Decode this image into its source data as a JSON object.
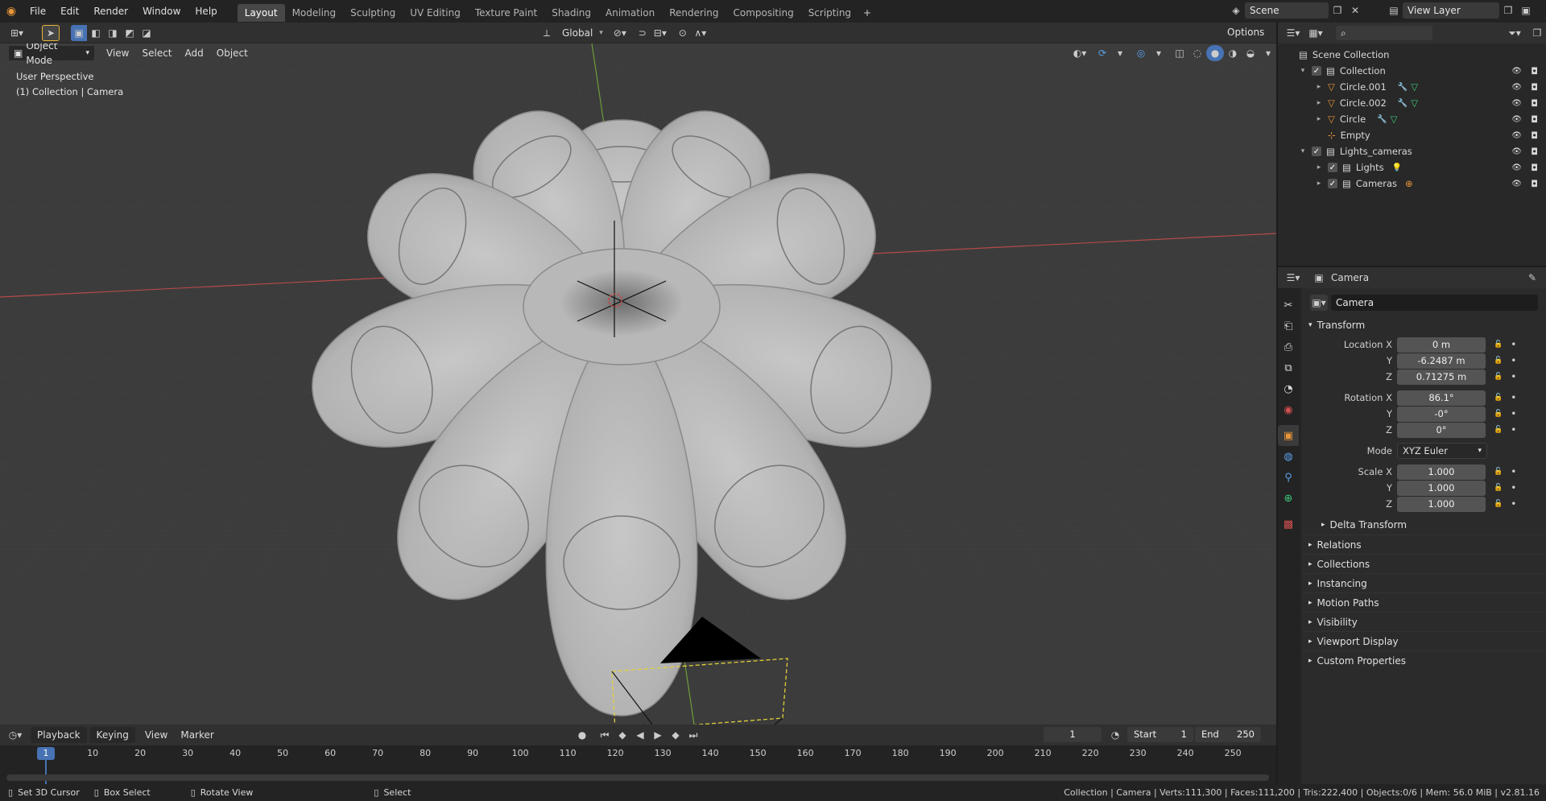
{
  "menubar": {
    "items": [
      "File",
      "Edit",
      "Render",
      "Window",
      "Help"
    ],
    "workspaces": [
      "Layout",
      "Modeling",
      "Sculpting",
      "UV Editing",
      "Texture Paint",
      "Shading",
      "Animation",
      "Rendering",
      "Compositing",
      "Scripting"
    ],
    "active_workspace": "Layout",
    "add_tab": "+",
    "scene": "Scene",
    "view_layer": "View Layer"
  },
  "viewport": {
    "transform_orientation": "Global",
    "options_label": "Options",
    "mode": "Object Mode",
    "menus": [
      "View",
      "Select",
      "Add",
      "Object"
    ],
    "perspective_label": "User Perspective",
    "context_label": "(1) Collection | Camera"
  },
  "outliner": {
    "root": "Scene Collection",
    "items": [
      {
        "name": "Collection",
        "kind": "collection"
      },
      {
        "name": "Circle.001",
        "kind": "mesh"
      },
      {
        "name": "Circle.002",
        "kind": "mesh"
      },
      {
        "name": "Circle",
        "kind": "mesh"
      },
      {
        "name": "Empty",
        "kind": "empty"
      },
      {
        "name": "Lights_cameras",
        "kind": "collection"
      },
      {
        "name": "Lights",
        "kind": "collection"
      },
      {
        "name": "Cameras",
        "kind": "collection"
      }
    ]
  },
  "properties": {
    "header_object": "Camera",
    "object_name": "Camera",
    "transform_label": "Transform",
    "location_label": "Location X",
    "rotation_label": "Rotation X",
    "scale_label": "Scale X",
    "y_label": "Y",
    "z_label": "Z",
    "mode_label": "Mode",
    "location": [
      "0 m",
      "-6.2487 m",
      "0.71275 m"
    ],
    "rotation": [
      "86.1°",
      "-0°",
      "0°"
    ],
    "mode": "XYZ Euler",
    "scale": [
      "1.000",
      "1.000",
      "1.000"
    ],
    "delta_transform": "Delta Transform",
    "panels": [
      "Relations",
      "Collections",
      "Instancing",
      "Motion Paths",
      "Visibility",
      "Viewport Display",
      "Custom Properties"
    ]
  },
  "timeline": {
    "menus": [
      "Playback",
      "Keying",
      "View",
      "Marker"
    ],
    "current_frame": "1",
    "start_label": "Start",
    "start": "1",
    "end_label": "End",
    "end": "250",
    "ticks": [
      "10",
      "20",
      "30",
      "40",
      "50",
      "60",
      "70",
      "80",
      "90",
      "100",
      "110",
      "120",
      "130",
      "140",
      "150",
      "160",
      "170",
      "180",
      "190",
      "200",
      "210",
      "220",
      "230",
      "240",
      "250"
    ],
    "cursor_frame": "1"
  },
  "statusbar": {
    "hints": [
      "Set 3D Cursor",
      "Box Select",
      "Rotate View",
      "Select"
    ],
    "stats": "Collection | Camera | Verts:111,300 | Faces:111,200 | Tris:222,400 | Objects:0/6 | Mem: 56.0 MiB | v2.81.16"
  },
  "colors": {
    "accent_blue": "#4772b3",
    "viewport_bg": "#3c3c3c",
    "panel_bg": "#282828",
    "mesh_orange": "#e8963a",
    "modifier_blue": "#5aa0e8",
    "data_green": "#3ec77a"
  }
}
